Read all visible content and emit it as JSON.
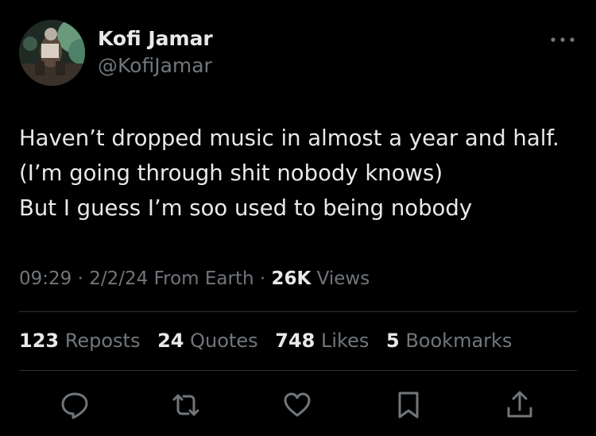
{
  "author": {
    "display_name": "Kofi Jamar",
    "handle": "@KofiJamar"
  },
  "tweet": {
    "lines": [
      "Haven’t dropped music in almost a year and half.",
      "(I’m going through shit nobody knows)",
      "But I guess I’m soo used to being nobody"
    ]
  },
  "meta": {
    "time": "09:29",
    "date": "2/2/24",
    "location": "From Earth",
    "sep1": "·",
    "sep2": "·",
    "views_count": "26K",
    "views_label": "Views"
  },
  "stats": {
    "reposts": {
      "count": "123",
      "label": "Reposts"
    },
    "quotes": {
      "count": "24",
      "label": "Quotes"
    },
    "likes": {
      "count": "748",
      "label": "Likes"
    },
    "bookmarks": {
      "count": "5",
      "label": "Bookmarks"
    }
  },
  "actions": [
    "reply-icon",
    "repost-icon",
    "like-icon",
    "bookmark-icon",
    "share-icon"
  ],
  "colors": {
    "background": "#000000",
    "primary_text": "#e7e9ea",
    "secondary_text": "#71767b",
    "divider": "#2f3336"
  }
}
